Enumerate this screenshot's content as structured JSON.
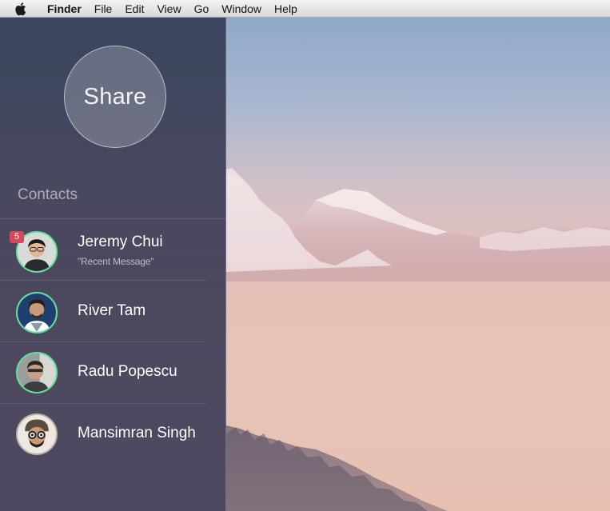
{
  "menubar": {
    "app_name": "Finder",
    "items": [
      "File",
      "Edit",
      "View",
      "Go",
      "Window",
      "Help"
    ]
  },
  "sidebar": {
    "share_label": "Share",
    "contacts_heading": "Contacts",
    "contacts": [
      {
        "name": "Jeremy Chui",
        "message": "\"Recent Message\"",
        "badge": "5"
      },
      {
        "name": "River Tam"
      },
      {
        "name": "Radu Popescu"
      },
      {
        "name": "Mansimran Singh"
      }
    ]
  },
  "colors": {
    "avatar_ring": "#5fe09c",
    "badge": "#d9475a",
    "sidebar_tint": "#2e3350"
  }
}
